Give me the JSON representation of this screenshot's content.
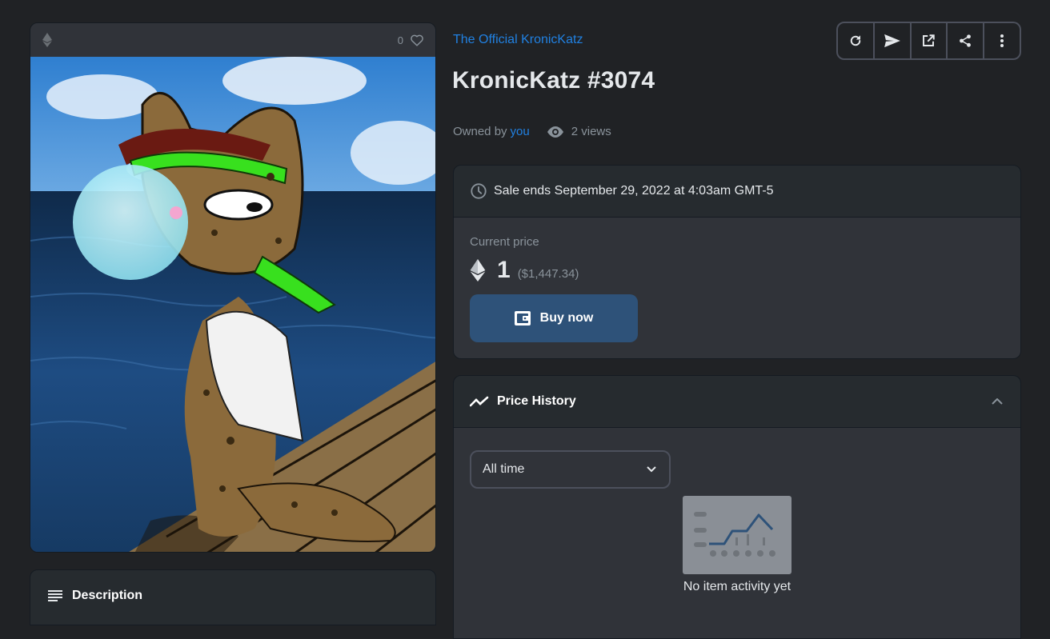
{
  "media": {
    "favorite_count": "0",
    "artwork_alt": "KronicKatz #3074"
  },
  "description": {
    "title": "Description"
  },
  "item": {
    "collection": "The Official KronicKatz",
    "title": "KronicKatz #3074",
    "owned_by_label": "Owned by",
    "owner": "you",
    "views": "2 views"
  },
  "toolbar": {
    "icons": [
      "refresh-icon",
      "send-icon",
      "external-link-icon",
      "share-icon",
      "more-icon"
    ]
  },
  "sale": {
    "ends": "Sale ends September 29, 2022 at 4:03am GMT-5",
    "price_label": "Current price",
    "price": "1",
    "price_usd": "($1,447.34)",
    "buy_label": "Buy now"
  },
  "history": {
    "title": "Price History",
    "range": "All time",
    "empty": "No item activity yet"
  },
  "colors": {
    "background": "#202225",
    "card": "#262b2f",
    "link": "#2081e2",
    "buy_button": "#2e5279"
  }
}
